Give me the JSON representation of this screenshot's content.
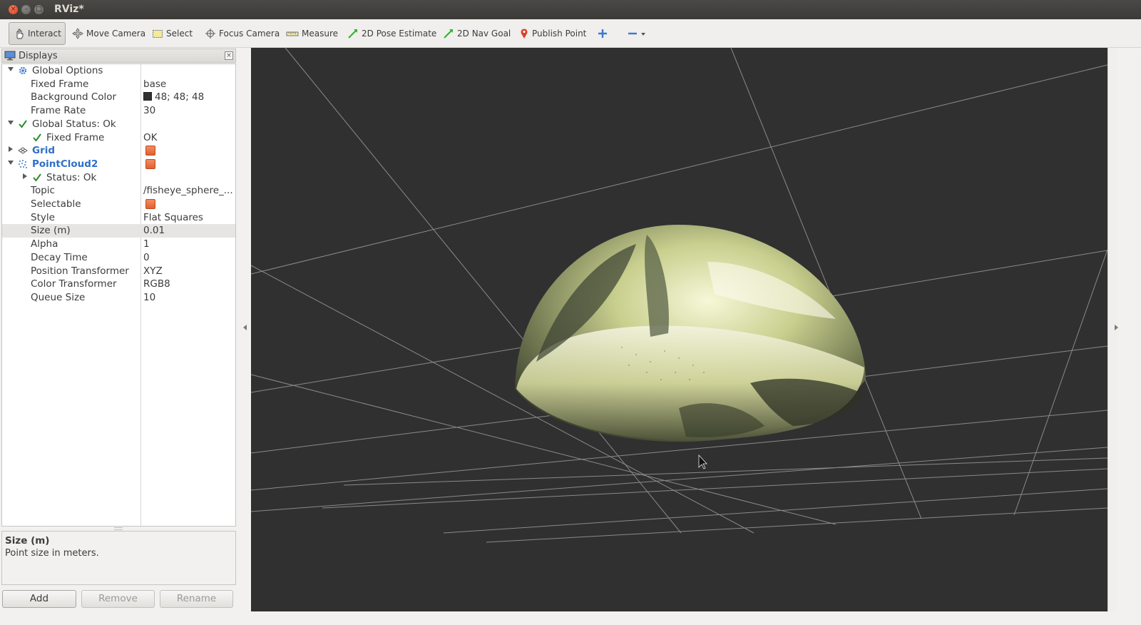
{
  "window": {
    "title": "RViz*"
  },
  "toolbar": {
    "items": [
      {
        "label": "Interact",
        "icon": "hand-pointer-icon",
        "active": true
      },
      {
        "label": "Move Camera",
        "icon": "move-camera-icon"
      },
      {
        "label": "Select",
        "icon": "select-rect-icon"
      },
      {
        "label": "Focus Camera",
        "icon": "crosshair-icon"
      },
      {
        "label": "Measure",
        "icon": "ruler-icon"
      },
      {
        "label": "2D Pose Estimate",
        "icon": "green-arrow-icon"
      },
      {
        "label": "2D Nav Goal",
        "icon": "green-arrow-icon"
      },
      {
        "label": "Publish Point",
        "icon": "map-pin-icon"
      }
    ]
  },
  "displays_panel": {
    "title": "Displays",
    "rows": [
      {
        "name": "Global Options",
        "value": ""
      },
      {
        "name": "Fixed Frame",
        "value": "base"
      },
      {
        "name": "Background Color",
        "value": "48; 48; 48"
      },
      {
        "name": "Frame Rate",
        "value": "30"
      },
      {
        "name": "Global Status: Ok",
        "value": ""
      },
      {
        "name": "Fixed Frame",
        "value": "OK"
      },
      {
        "name": "Grid",
        "value": ""
      },
      {
        "name": "PointCloud2",
        "value": ""
      },
      {
        "name": "Status: Ok",
        "value": ""
      },
      {
        "name": "Topic",
        "value": "/fisheye_sphere_..."
      },
      {
        "name": "Selectable",
        "value": ""
      },
      {
        "name": "Style",
        "value": "Flat Squares"
      },
      {
        "name": "Size (m)",
        "value": "0.01"
      },
      {
        "name": "Alpha",
        "value": "1"
      },
      {
        "name": "Decay Time",
        "value": "0"
      },
      {
        "name": "Position Transformer",
        "value": "XYZ"
      },
      {
        "name": "Color Transformer",
        "value": "RGB8"
      },
      {
        "name": "Queue Size",
        "value": "10"
      }
    ],
    "background_color_hex": "#303030",
    "checkbox_color": "#e8693a",
    "link_color": "#2f6fc7"
  },
  "description": {
    "title": "Size (m)",
    "text": "Point size in meters."
  },
  "buttons": {
    "add": "Add",
    "remove": "Remove",
    "rename": "Rename"
  }
}
